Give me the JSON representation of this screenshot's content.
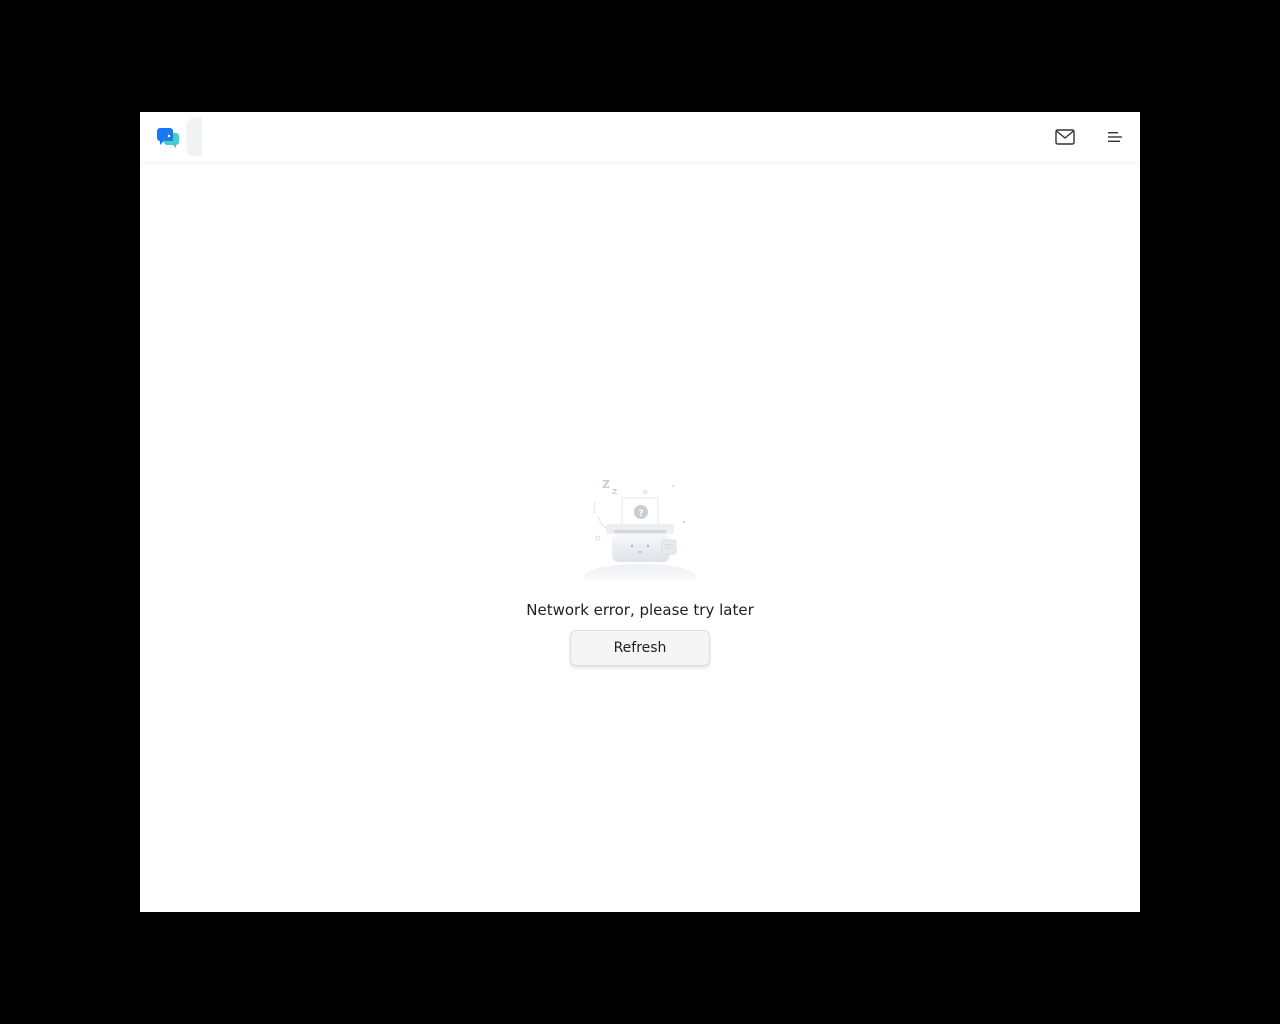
{
  "header": {
    "logo_icon": "app-chat-logo-icon",
    "mail_icon": "mail-icon",
    "menu_icon": "hamburger-menu-icon"
  },
  "error": {
    "message": "Network error, please try later",
    "refresh_label": "Refresh",
    "illustration_icon": "sleeping-printer-illustration"
  },
  "colors": {
    "logo_primary": "#1677ff",
    "logo_secondary": "#2ec5ce",
    "background": "#ffffff",
    "button_bg": "#f5f5f6"
  }
}
